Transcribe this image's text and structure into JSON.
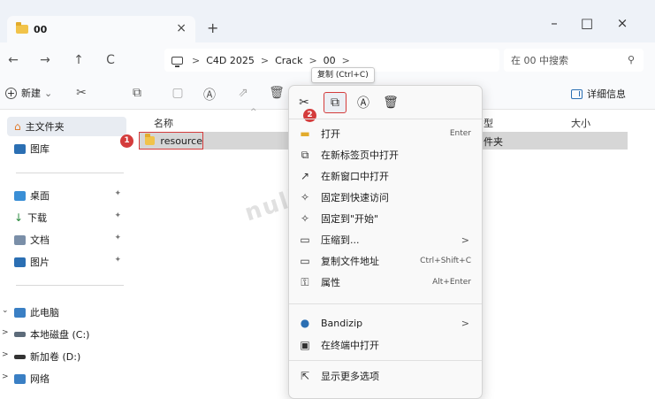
{
  "tab": {
    "title": "00",
    "close": "×",
    "add": "+"
  },
  "window": {
    "minimize": "–",
    "maximize": "□",
    "close": "×"
  },
  "nav": {
    "back": "←",
    "forward": "→",
    "up": "↑",
    "refresh": "C"
  },
  "address": {
    "sep": ">",
    "crumbs": [
      "C4D 2025",
      "Crack",
      "00"
    ],
    "trailing_sep": ">"
  },
  "search": {
    "placeholder": "在 00 中搜索",
    "icon": "⚲"
  },
  "toolbar": {
    "new_label": "新建",
    "new_chevron": "⌄",
    "details_label": "详细信息"
  },
  "sidebar": {
    "home": "主文件夹",
    "gallery": "图库",
    "quick": [
      {
        "label": "桌面",
        "pin": "✦"
      },
      {
        "label": "下载",
        "pin": "✦"
      },
      {
        "label": "文档",
        "pin": "✦"
      },
      {
        "label": "图片",
        "pin": "✦"
      }
    ],
    "tree": [
      {
        "chev": "⌄",
        "label": "此电脑"
      },
      {
        "chev": ">",
        "label": "本地磁盘 (C:)"
      },
      {
        "chev": ">",
        "label": "新加卷 (D:)"
      },
      {
        "chev": ">",
        "label": "网络"
      }
    ]
  },
  "columns": {
    "name": "名称",
    "type": "型",
    "size": "大小"
  },
  "files": [
    {
      "name": "resource",
      "type": "件夹"
    }
  ],
  "badges": {
    "one": "1",
    "two": "2"
  },
  "watermark": "nullterminator",
  "tooltip": "复制 (Ctrl+C)",
  "context_menu": {
    "items": [
      {
        "icon": "📂",
        "label": "打开",
        "shortcut": "Enter",
        "arrow": ""
      },
      {
        "icon": "⧉",
        "label": "在新标签页中打开",
        "shortcut": "",
        "arrow": ""
      },
      {
        "icon": "↗",
        "label": "在新窗口中打开",
        "shortcut": "",
        "arrow": ""
      },
      {
        "icon": "✧",
        "label": "固定到快速访问",
        "shortcut": "",
        "arrow": ""
      },
      {
        "icon": "✧",
        "label": "固定到\"开始\"",
        "shortcut": "",
        "arrow": ""
      },
      {
        "icon": "▭",
        "label": "压缩到...",
        "shortcut": "",
        "arrow": ">"
      },
      {
        "icon": "▭",
        "label": "复制文件地址",
        "shortcut": "Ctrl+Shift+C",
        "arrow": ""
      },
      {
        "icon": "⚿",
        "label": "属性",
        "shortcut": "Alt+Enter",
        "arrow": ""
      },
      {
        "icon": "●",
        "label": "Bandizip",
        "shortcut": "",
        "arrow": ">"
      },
      {
        "icon": "▣",
        "label": "在终端中打开",
        "shortcut": "",
        "arrow": ""
      },
      {
        "icon": "⇱",
        "label": "显示更多选项",
        "shortcut": "",
        "arrow": ""
      }
    ]
  },
  "colors": {
    "accent": "#2b6fb3",
    "highlight_red": "#d43c3c",
    "folder": "#f1c34a"
  }
}
